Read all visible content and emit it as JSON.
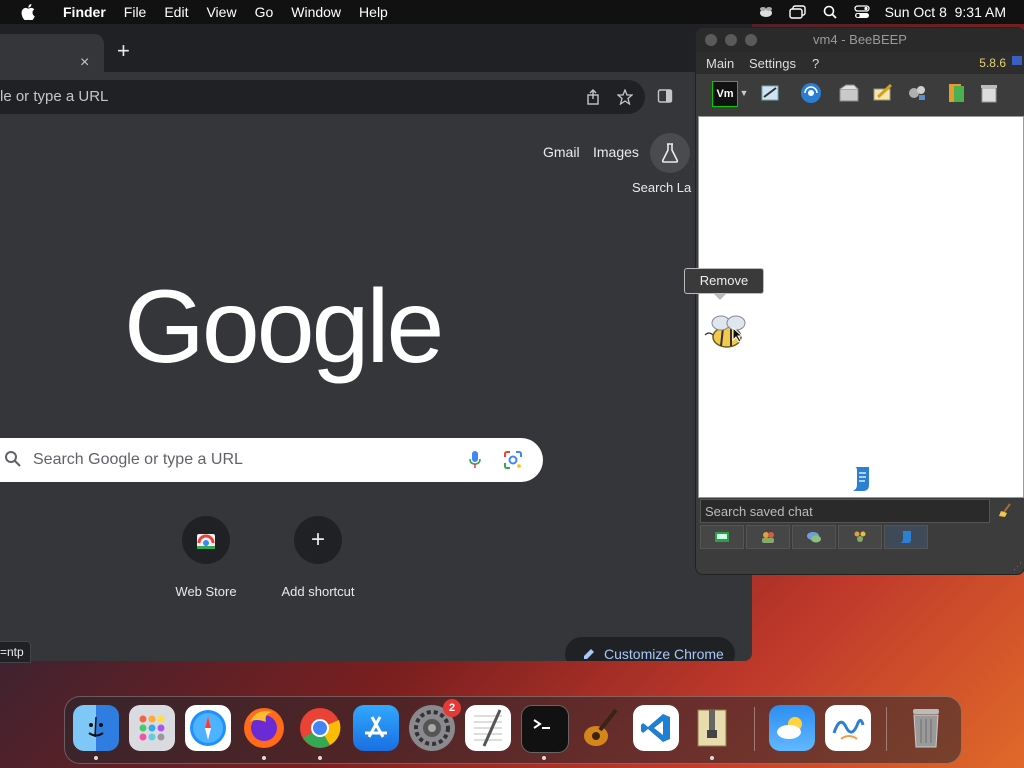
{
  "menubar": {
    "items": [
      "Finder",
      "File",
      "Edit",
      "View",
      "Go",
      "Window",
      "Help"
    ],
    "datetime": "Sun Oct 8  9:31 AM"
  },
  "chrome": {
    "new_tab_symbol": "+",
    "close_tab_symbol": "×",
    "omnibox_text": "le or type a URL",
    "ntp": {
      "gmail": "Gmail",
      "images": "Images",
      "search_labs": "Search La",
      "logo": "Google",
      "search_placeholder": "Search Google or type a URL",
      "shortcuts": [
        {
          "label": "Web Store",
          "icon": "web-store-icon"
        },
        {
          "label": "Add shortcut",
          "icon": "plus-icon",
          "symbol": "+"
        }
      ],
      "customize": "Customize Chrome",
      "status_url": "=ntp"
    }
  },
  "beebeep": {
    "title": "vm4 - BeeBEEP",
    "menu": [
      "Main",
      "Settings",
      "?"
    ],
    "version": "5.8.6",
    "toolbar_vm_label": "Vm",
    "tooltip": "Remove",
    "search_placeholder": "Search saved chat"
  },
  "dock": {
    "apps": [
      "Finder",
      "Launchpad",
      "Safari",
      "Firefox",
      "Chrome",
      "App Store",
      "System Settings",
      "TextEdit",
      "Terminal",
      "GarageBand",
      "VS Code",
      "Archive Utility",
      "Weather",
      "Freeform",
      "Trash"
    ],
    "settings_badge": "2"
  },
  "colors": {
    "chrome_bg": "#35363a",
    "chrome_dark": "#202124",
    "accent_blue": "#a8c7fa",
    "beebeep_version": "#e8d36a"
  }
}
